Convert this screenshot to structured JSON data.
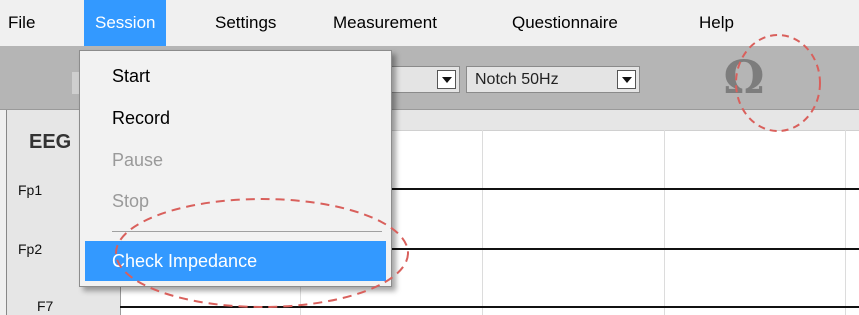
{
  "menubar": {
    "items": [
      "File",
      "Session",
      "Settings",
      "Measurement",
      "Questionnaire",
      "Help"
    ],
    "open_item": "Session"
  },
  "toolbar": {
    "filter_select": {
      "value": "Notch 50Hz"
    },
    "impedance_icon": {
      "glyph": "Ω",
      "name": "omega-icon"
    }
  },
  "session_menu": {
    "items": [
      {
        "label": "Start",
        "enabled": true
      },
      {
        "label": "Record",
        "enabled": true
      },
      {
        "label": "Pause",
        "enabled": false
      },
      {
        "label": "Stop",
        "enabled": false
      },
      {
        "label": "Check Impedance",
        "enabled": true,
        "highlighted": true
      }
    ]
  },
  "eeg": {
    "title": "EEG",
    "channels": [
      "Fp1",
      "Fp2",
      "F7"
    ]
  },
  "colors": {
    "highlight": "#3399ff",
    "toolbar_bg": "#b5b5b5",
    "annotation": "#d9605c"
  }
}
